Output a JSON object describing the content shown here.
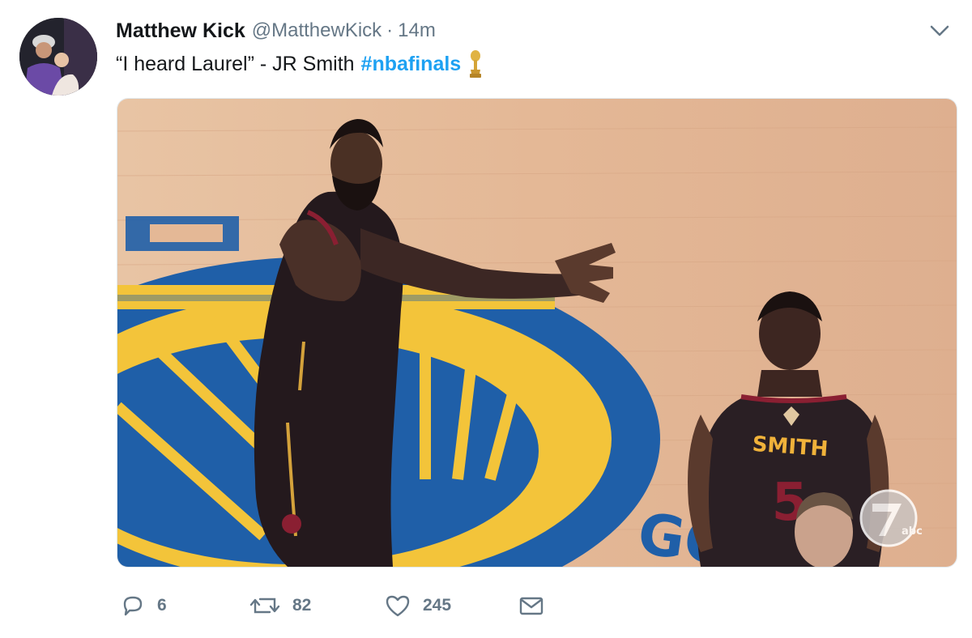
{
  "tweet": {
    "author_name": "Matthew Kick",
    "author_handle": "@MatthewKick",
    "separator": "·",
    "timestamp": "14m",
    "text": "“I heard Laurel” - JR Smith",
    "hashtag": "#nbafinals",
    "emoji": "trophy-icon"
  },
  "media": {
    "jersey_name": "SMITH",
    "jersey_number": "5",
    "floor_letters": "GO",
    "broadcaster_text": "abc"
  },
  "actions": {
    "reply_count": "6",
    "retweet_count": "82",
    "like_count": "245"
  },
  "colors": {
    "hashtag": "#1da1f2",
    "muted": "#657786",
    "court_blue": "#1f5fa8",
    "court_gold": "#f3c43a",
    "floor_wood": "#e2b695"
  }
}
